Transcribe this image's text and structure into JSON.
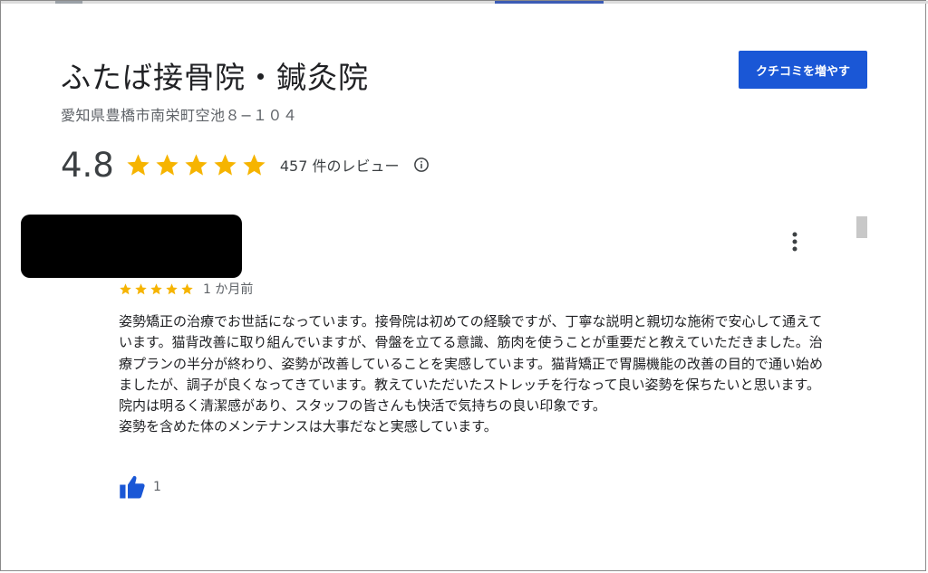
{
  "place": {
    "title": "ふたば接骨院・鍼灸院",
    "address": "愛知県豊橋市南栄町空池８−１０４",
    "cta_label": "クチコミを増やす"
  },
  "summary": {
    "rating": "4.8",
    "rating_value": 4.8,
    "stars_filled": 5,
    "review_count_text": "457 件のレビュー",
    "info_icon": "info-icon"
  },
  "review": {
    "author_redacted": true,
    "stars": 5,
    "time": "1 か月前",
    "paragraphs": [
      "姿勢矯正の治療でお世話になっています。接骨院は初めての経験ですが、丁寧な説明と親切な施術で安心して通えています。猫背改善に取り組んでいますが、骨盤を立てる意識、筋肉を使うことが重要だと教えていただきました。治療プランの半分が終わり、姿勢が改善していることを実感しています。猫背矯正で胃腸機能の改善の目的で通い始めましたが、調子が良くなってきています。教えていただいたストレッチを行なって良い姿勢を保ちたいと思います。",
      "院内は明るく清潔感があり、スタッフの皆さんも快活で気持ちの良い印象です。",
      "姿勢を含めた体のメンテナンスは大事だなと実感しています。"
    ],
    "likes": "1",
    "more_icon": "more-vert-icon",
    "like_icon": "thumb-up-icon"
  },
  "colors": {
    "star": "#f6b400",
    "button": "#1a57d6",
    "like": "#1a57d6",
    "text": "#202124",
    "muted": "#5f6368"
  }
}
